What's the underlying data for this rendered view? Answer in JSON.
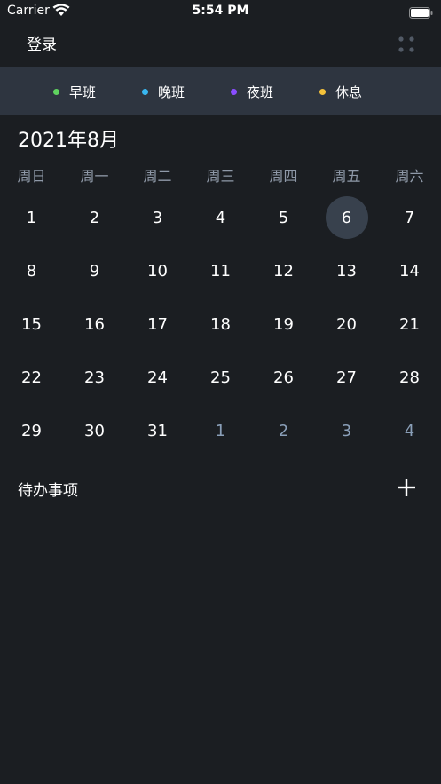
{
  "status_bar": {
    "carrier": "Carrier",
    "time": "5:54 PM"
  },
  "nav": {
    "login_label": "登录"
  },
  "legend": [
    {
      "label": "早班",
      "color": "#5fd35f"
    },
    {
      "label": "晚班",
      "color": "#38b6f0"
    },
    {
      "label": "夜班",
      "color": "#8a4dff"
    },
    {
      "label": "休息",
      "color": "#f5c23a"
    }
  ],
  "calendar": {
    "month_title": "2021年8月",
    "weekdays": [
      "周日",
      "周一",
      "周二",
      "周三",
      "周四",
      "周五",
      "周六"
    ],
    "selected_day": "6",
    "weeks": [
      [
        {
          "d": "1",
          "m": "cur"
        },
        {
          "d": "2",
          "m": "cur"
        },
        {
          "d": "3",
          "m": "cur"
        },
        {
          "d": "4",
          "m": "cur"
        },
        {
          "d": "5",
          "m": "cur"
        },
        {
          "d": "6",
          "m": "cur"
        },
        {
          "d": "7",
          "m": "cur"
        }
      ],
      [
        {
          "d": "8",
          "m": "cur"
        },
        {
          "d": "9",
          "m": "cur"
        },
        {
          "d": "10",
          "m": "cur"
        },
        {
          "d": "11",
          "m": "cur"
        },
        {
          "d": "12",
          "m": "cur"
        },
        {
          "d": "13",
          "m": "cur"
        },
        {
          "d": "14",
          "m": "cur"
        }
      ],
      [
        {
          "d": "15",
          "m": "cur"
        },
        {
          "d": "16",
          "m": "cur"
        },
        {
          "d": "17",
          "m": "cur"
        },
        {
          "d": "18",
          "m": "cur"
        },
        {
          "d": "19",
          "m": "cur"
        },
        {
          "d": "20",
          "m": "cur"
        },
        {
          "d": "21",
          "m": "cur"
        }
      ],
      [
        {
          "d": "22",
          "m": "cur"
        },
        {
          "d": "23",
          "m": "cur"
        },
        {
          "d": "24",
          "m": "cur"
        },
        {
          "d": "25",
          "m": "cur"
        },
        {
          "d": "26",
          "m": "cur"
        },
        {
          "d": "27",
          "m": "cur"
        },
        {
          "d": "28",
          "m": "cur"
        }
      ],
      [
        {
          "d": "29",
          "m": "cur"
        },
        {
          "d": "30",
          "m": "cur"
        },
        {
          "d": "31",
          "m": "cur"
        },
        {
          "d": "1",
          "m": "next"
        },
        {
          "d": "2",
          "m": "next"
        },
        {
          "d": "3",
          "m": "next"
        },
        {
          "d": "4",
          "m": "next"
        }
      ]
    ]
  },
  "todo": {
    "title": "待办事项"
  },
  "icons": {
    "wifi": "wifi-icon",
    "battery": "battery-icon",
    "menu": "menu-dots-icon",
    "add": "plus-icon"
  },
  "colors": {
    "background": "#1b1e22",
    "legend_background": "#2e3540",
    "selected_day": "#38414d",
    "weekday_text": "#8f99a8",
    "other_month_text": "#8a9fb8"
  }
}
